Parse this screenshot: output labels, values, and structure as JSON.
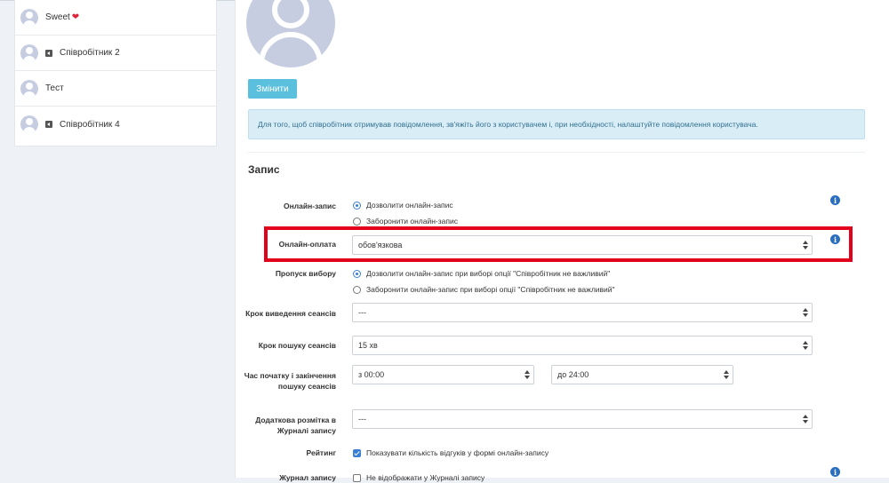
{
  "sidebar": {
    "items": [
      {
        "name": "Sweet",
        "heart": "❤",
        "shared": false
      },
      {
        "name": "Співробітник 2",
        "heart": "",
        "shared": true
      },
      {
        "name": "Тест",
        "heart": "",
        "shared": false
      },
      {
        "name": "Співробітник 4",
        "heart": "",
        "shared": true
      }
    ]
  },
  "profile": {
    "change_button": "Змінити",
    "alert_text": "Для того, щоб співробітник отримував повідомлення, зв'яжіть його з користувачем і, при необхідності, налаштуйте повідомлення користувача."
  },
  "section": {
    "title": "Запис"
  },
  "form": {
    "online_booking": {
      "label": "Онлайн-запис",
      "option_allow": "Дозволити онлайн-запис",
      "option_deny": "Заборонити онлайн-запис"
    },
    "online_payment": {
      "label": "Онлайн-оплата",
      "value": "обов'язкова"
    },
    "skip_choice": {
      "label": "Пропуск вибору",
      "option_allow": "Дозволити онлайн-запис при виборі опції \"Співробітник не важливий\"",
      "option_deny": "Заборонити онлайн-запис при виборі опції \"Співробітник не важливий\""
    },
    "session_step": {
      "label": "Крок виведення сеансів",
      "value": "---"
    },
    "search_step": {
      "label": "Крок пошуку сеансів",
      "value": "15 хв"
    },
    "time_range": {
      "label": "Час початку і закінчення пошуку сеансів",
      "from": "з 00:00",
      "to": "до 24:00"
    },
    "extra_markup": {
      "label": "Додаткова розмітка в Журналі запису",
      "value": "---"
    },
    "rating": {
      "label": "Рейтинг",
      "checkbox_label": "Показувати кількість відгуків у формі онлайн-запису"
    },
    "journal": {
      "label": "Журнал запису",
      "checkbox_label": "Не відображати у Журналі запису"
    }
  },
  "colors": {
    "accent": "#5bc0de",
    "highlight": "#e3001b",
    "info": "#2a6fbf",
    "alert_bg": "#d9edf7"
  },
  "icons": {
    "info": "info-icon",
    "avatar": "avatar-icon",
    "share": "share-icon"
  }
}
